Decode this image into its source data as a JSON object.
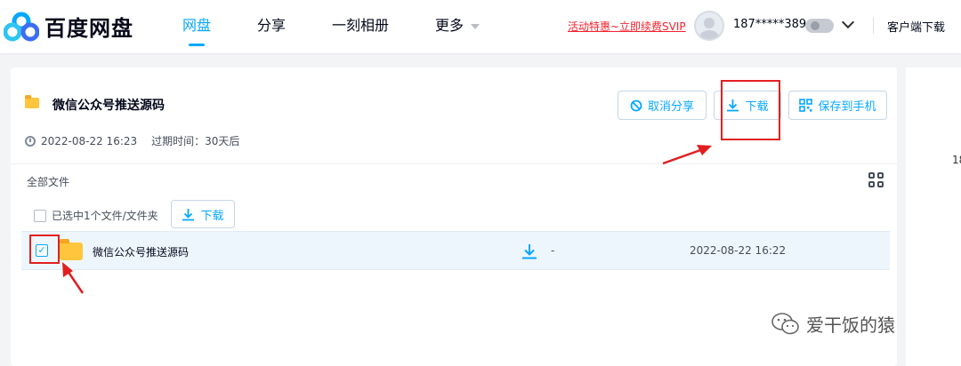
{
  "header": {
    "logo_text": "百度网盘",
    "nav": [
      {
        "label": "网盘",
        "active": true
      },
      {
        "label": "分享",
        "active": false
      },
      {
        "label": "一刻相册",
        "active": false
      },
      {
        "label": "更多",
        "active": false
      }
    ],
    "promo_text": "活动特惠~立即续费SVIP",
    "username": "187*****389",
    "client_download": "客户端下载"
  },
  "share": {
    "title": "微信公众号推送源码",
    "date": "2022-08-22 16:23",
    "expire_label": "过期时间：30天后",
    "buttons": {
      "cancel_share": "取消分享",
      "download": "下载",
      "save_to_phone": "保存到手机"
    }
  },
  "files": {
    "all_files_label": "全部文件",
    "selection_text": "已选中1个文件/文件夹",
    "selection_download": "下载",
    "rows": [
      {
        "name": "微信公众号推送源码",
        "size": "-",
        "date": "2022-08-22 16:22",
        "checked": true
      }
    ]
  },
  "side": {
    "partial_text": "18"
  },
  "watermark": "爱干饭的猿",
  "colors": {
    "accent": "#06a7ff",
    "promo": "#f5222d",
    "annotation": "#e02020"
  }
}
